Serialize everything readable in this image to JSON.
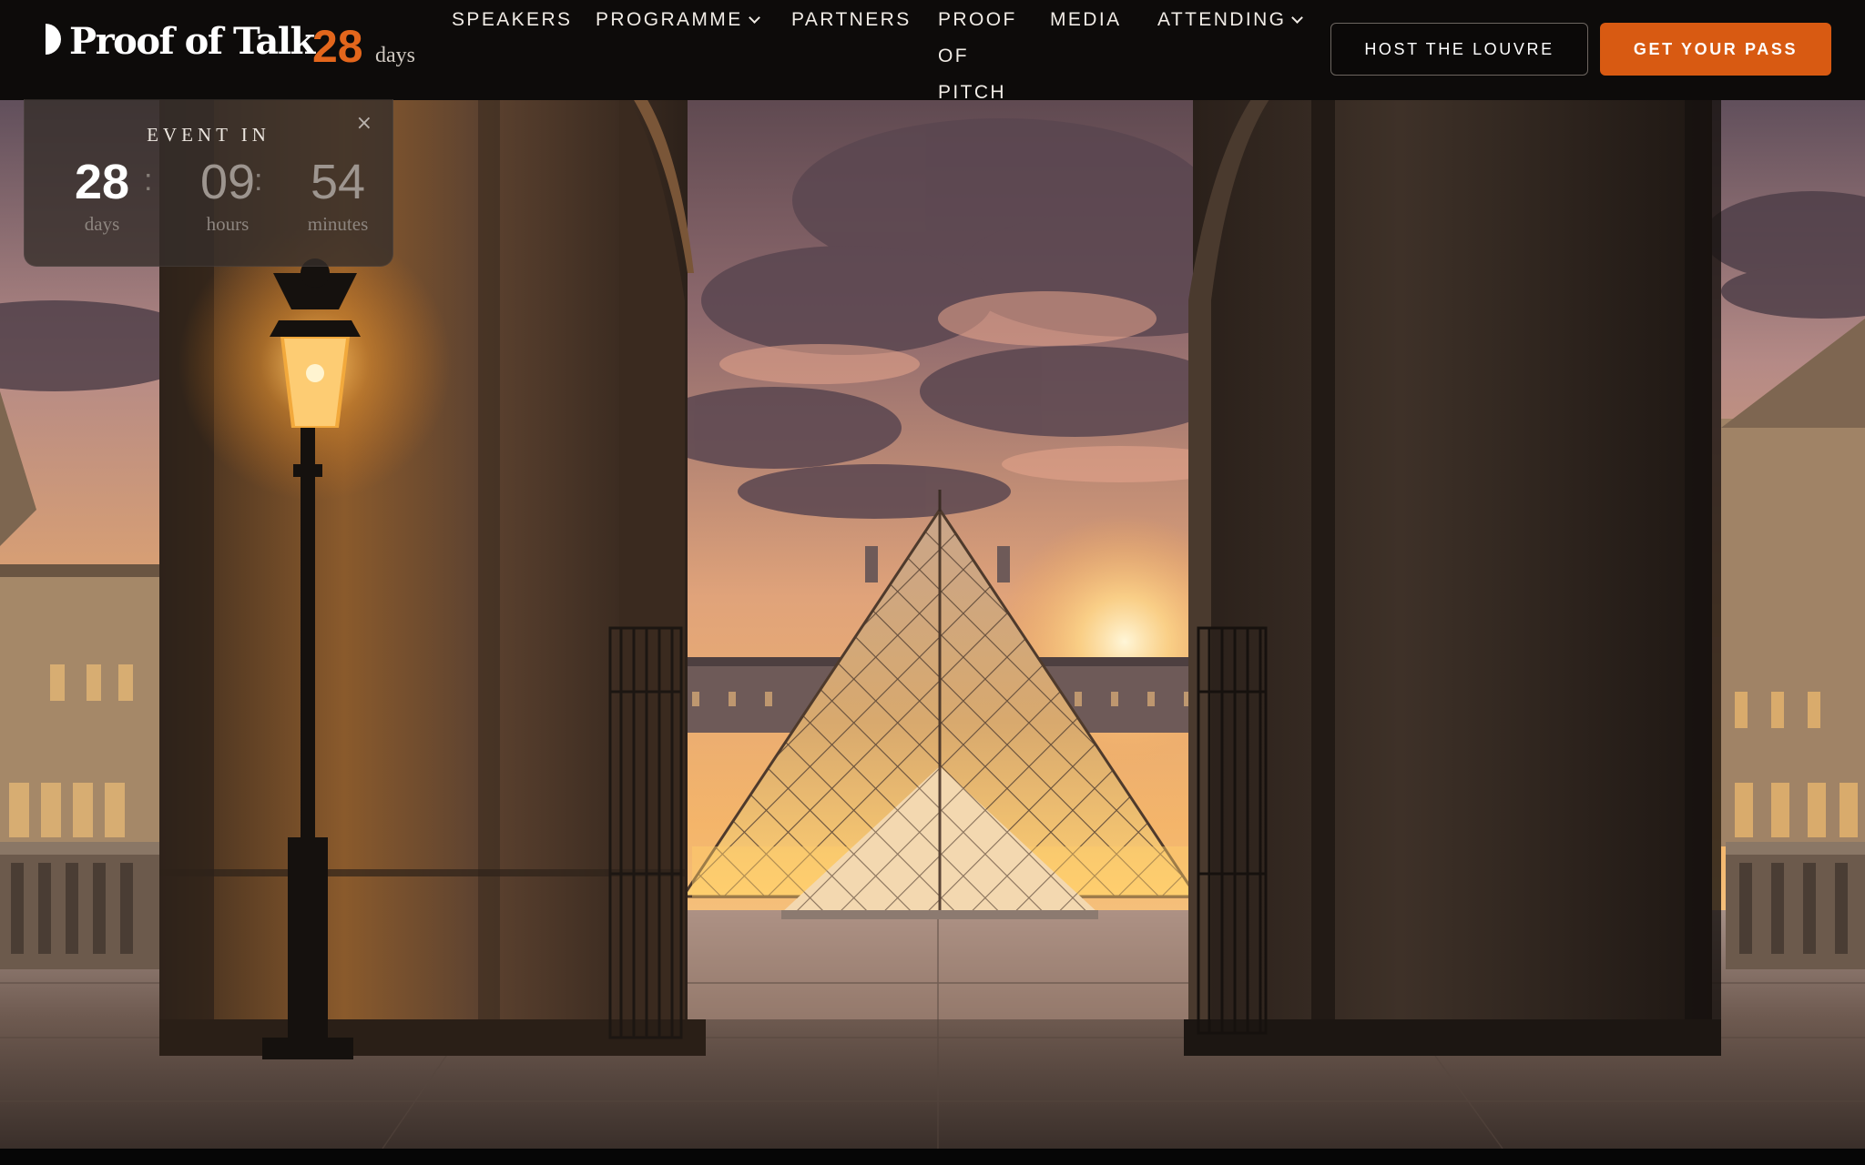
{
  "brand": {
    "name": "Proof of Talk",
    "countdown_value": "28",
    "countdown_unit": "days"
  },
  "nav": {
    "items": [
      {
        "label": "SPEAKERS",
        "has_dropdown": false
      },
      {
        "label": "PROGRAMME",
        "has_dropdown": true
      },
      {
        "label": "PARTNERS",
        "has_dropdown": false
      },
      {
        "label": "PROOF OF PITCH",
        "has_dropdown": false
      },
      {
        "label": "MEDIA",
        "has_dropdown": false
      },
      {
        "label": "ATTENDING",
        "has_dropdown": true
      }
    ],
    "host_button": "HOST THE LOUVRE",
    "pass_button": "GET YOUR PASS"
  },
  "countdown": {
    "title": "EVENT IN",
    "close": "×",
    "days": {
      "value": "28",
      "label": "days"
    },
    "hours": {
      "value": "09",
      "label": "hours"
    },
    "minutes": {
      "value": "54",
      "label": "minutes"
    },
    "separator": ":"
  },
  "hero": {
    "scene": "Louvre pyramid framed by archway at sunset"
  },
  "colors": {
    "accent": "#D85A12",
    "accent_text": "#E3661C",
    "nav_bg": "#0D0B0A",
    "text": "#F1ECE6"
  },
  "icons": {
    "brand_mark": "half-moon-logo-icon",
    "dropdown": "chevron-down-icon",
    "close": "close-icon"
  }
}
